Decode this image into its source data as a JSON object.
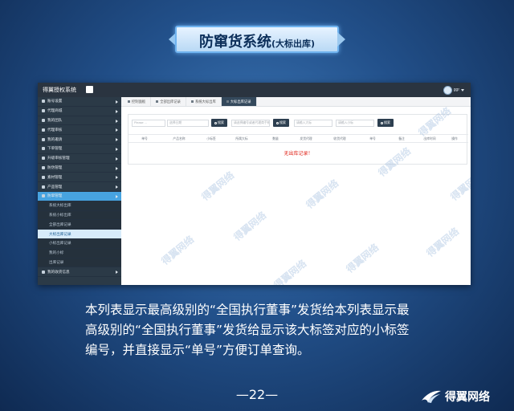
{
  "banner": {
    "title": "防窜货系统",
    "subtitle": "(大标出库)"
  },
  "app": {
    "brand": "得翼授权系统",
    "user": "ggr"
  },
  "sidebar": {
    "items": [
      {
        "label": "账号设置",
        "type": "top"
      },
      {
        "label": "代理商城",
        "type": "top"
      },
      {
        "label": "我的团队",
        "type": "top"
      },
      {
        "label": "代理审核",
        "type": "top"
      },
      {
        "label": "我的邀请",
        "type": "top"
      },
      {
        "label": "下单管理",
        "type": "top"
      },
      {
        "label": "升级审核管理",
        "type": "top"
      },
      {
        "label": "防伪管理",
        "type": "top"
      },
      {
        "label": "素材管理",
        "type": "top"
      },
      {
        "label": "产品管理",
        "type": "top"
      },
      {
        "label": "防窜管理",
        "type": "active"
      },
      {
        "label": "系统大标出库",
        "type": "sub"
      },
      {
        "label": "系统小标出库",
        "type": "sub"
      },
      {
        "label": "全部出库记录",
        "type": "sub"
      },
      {
        "label": "大标出库记录",
        "type": "subactive"
      },
      {
        "label": "小标出库记录",
        "type": "sub"
      },
      {
        "label": "我的小标",
        "type": "sub"
      },
      {
        "label": "出库记录",
        "type": "sub"
      },
      {
        "label": "我的收货信息",
        "type": "top"
      }
    ]
  },
  "tabs": [
    {
      "label": "控制面板",
      "active": false
    },
    {
      "label": "全部出库记录",
      "active": false
    },
    {
      "label": "系统大标出库",
      "active": false
    },
    {
      "label": "大标出库记录",
      "active": true
    }
  ],
  "filters": {
    "field1": "Please ...",
    "field2": "选择日期",
    "search1": "搜索",
    "field3": "请选择编号或者代理商手机",
    "search2": "搜索",
    "field4": "请输入大标",
    "field5": "请输入小标",
    "search3": "搜索"
  },
  "table": {
    "headers": [
      "单号",
      "产品名称",
      "小标签",
      "所属大标",
      "数量",
      "发货代理",
      "收货代理",
      "单号",
      "备注",
      "出库时间",
      "操作"
    ],
    "empty_text": "无出库记录！"
  },
  "watermark": "得翼网络",
  "caption": [
    "本列表显示最高级别的“全国执行董事”发货给本列表显示最",
    "高级别的“全国执行董事”发货给显示该大标签对应的小标签",
    "编号，并直接显示“单号”方便订单查询。"
  ],
  "page_number": "—22—",
  "logo_text": "得翼网络"
}
